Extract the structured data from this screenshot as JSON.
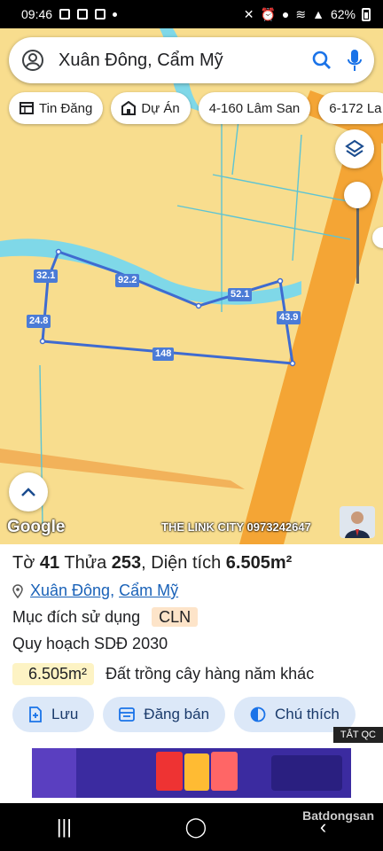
{
  "status_bar": {
    "time": "09:46",
    "battery": "62%"
  },
  "search": {
    "query": "Xuân Đông, Cẩm Mỹ"
  },
  "chips": [
    {
      "label": "Tin Đăng",
      "icon": "table-icon"
    },
    {
      "label": "Dự Án",
      "icon": "building-icon"
    },
    {
      "label": "4-160 Lâm San",
      "icon": ""
    },
    {
      "label": "6-172 La",
      "icon": ""
    }
  ],
  "map": {
    "labels": {
      "top_left": "32.1",
      "top": "92.2",
      "top_right": "52.1",
      "left": "24.8",
      "right": "43.9",
      "bottom": "148"
    },
    "google_logo": "Google",
    "watermark": "THE LINK CITY 0973242647",
    "colors": {
      "land": "#f8dd8e",
      "road": "#f4a535",
      "river": "#7fd8e8",
      "boundary": "#3f6bd0"
    }
  },
  "parcel": {
    "sheet_prefix": "Tờ",
    "sheet_no": "41",
    "lot_prefix": "Thửa",
    "lot_no": "253",
    "area_prefix": "Diện tích",
    "area": "6.505m²",
    "location_1": "Xuân Đông",
    "location_sep": ",",
    "location_2": "Cẩm Mỹ",
    "purpose_label": "Mục đích sử dụng",
    "purpose_code": "CLN",
    "plan_label": "Quy hoạch SDĐ 2030",
    "plan_area": "6.505m²",
    "plan_desc": "Đất trồng cây hàng năm khác"
  },
  "actions": [
    {
      "label": "Lưu",
      "icon": "save-icon"
    },
    {
      "label": "Đăng bán",
      "icon": "post-icon"
    },
    {
      "label": "Chú thích",
      "icon": "legend-icon"
    }
  ],
  "ad": {
    "close_label": "TẮT QC"
  },
  "brand": {
    "name": "Batdongsan"
  }
}
